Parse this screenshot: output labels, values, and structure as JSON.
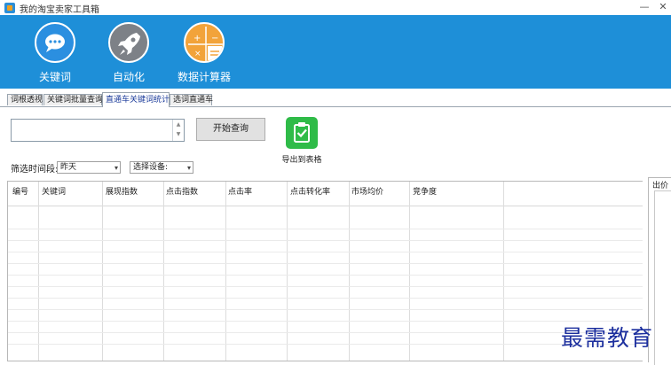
{
  "window": {
    "title": "我的淘宝卖家工具箱",
    "minimize": "—",
    "close": "✕"
  },
  "ribbon": [
    {
      "label": "关键词",
      "icon": "chat-bubble-icon",
      "color": "#2b8fe0"
    },
    {
      "label": "自动化",
      "icon": "rocket-icon",
      "color": "#7d8187"
    },
    {
      "label": "数据计算器",
      "icon": "calculator-icon",
      "color": "#f2a33a"
    }
  ],
  "tabs": [
    {
      "label": "词根透视"
    },
    {
      "label": "关键词批量查询"
    },
    {
      "label": "直通车关键词统计"
    },
    {
      "label": "选词直通车"
    }
  ],
  "toolbar": {
    "keyword_value": "",
    "query_button": "开始查询",
    "export_label": "导出到表格"
  },
  "filters": {
    "time_label": "筛选时间段:",
    "time_value": "昨天",
    "device_value": "选择设备:"
  },
  "grid": {
    "columns": [
      "编号",
      "关键词",
      "展现指数",
      "点击指数",
      "点击率",
      "点击转化率",
      "市场均价",
      "竞争度"
    ]
  },
  "side_panel": {
    "label": "出价"
  },
  "watermark": "最需教育"
}
